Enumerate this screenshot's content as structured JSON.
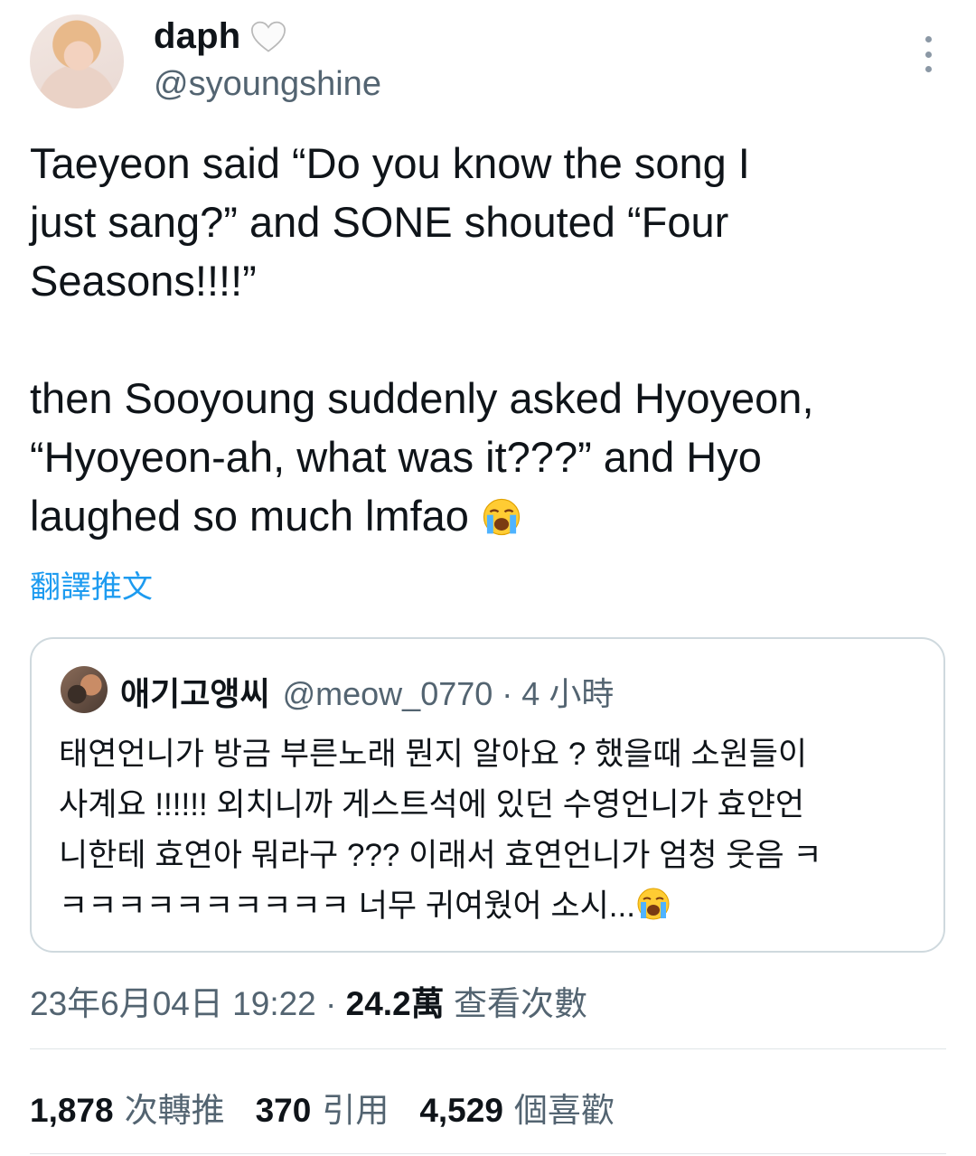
{
  "author": {
    "display_name": "daph",
    "handle": "@syoungshine",
    "badge_icon": "white-heart-icon"
  },
  "tweet": {
    "text": "Taeyeon said “Do you know the song I\njust sang?” and SONE shouted “Four\nSeasons!!!!”\n\nthen Sooyoung suddenly asked Hyoyeon,\n“Hyoyeon-ah, what was it???” and Hyo\nlaughed so much lmfao ",
    "emoji": "loudly-crying-face-emoji",
    "translate_label": "翻譯推文"
  },
  "quote": {
    "name": "애기고앵씨",
    "handle": "@meow_0770",
    "separator": "·",
    "time": "4 小時",
    "text": "태연언니가 방금 부른노래 뭔지 알아요 ? 했을때 소원들이\n사계요 !!!!!! 외치니까 게스트석에 있던 수영언니가 효얀언\n니한테 효연아 뭐라구 ??? 이래서 효연언니가 엄청 웃음 ㅋ\nㅋㅋㅋㅋㅋㅋㅋㅋㅋㅋ 너무 귀여웠어 소시..."
  },
  "meta": {
    "datetime": "23年6月04日 19:22",
    "separator": "·",
    "views": "24.2萬",
    "views_label": "查看次數"
  },
  "stats": {
    "retweets": "1,878",
    "retweets_label": "次轉推",
    "quotes": "370",
    "quotes_label": "引用",
    "likes": "4,529",
    "likes_label": "個喜歡"
  },
  "colors": {
    "text": "#0f1419",
    "secondary": "#536471",
    "link": "#1d9bf0",
    "border": "#cfd9de"
  }
}
